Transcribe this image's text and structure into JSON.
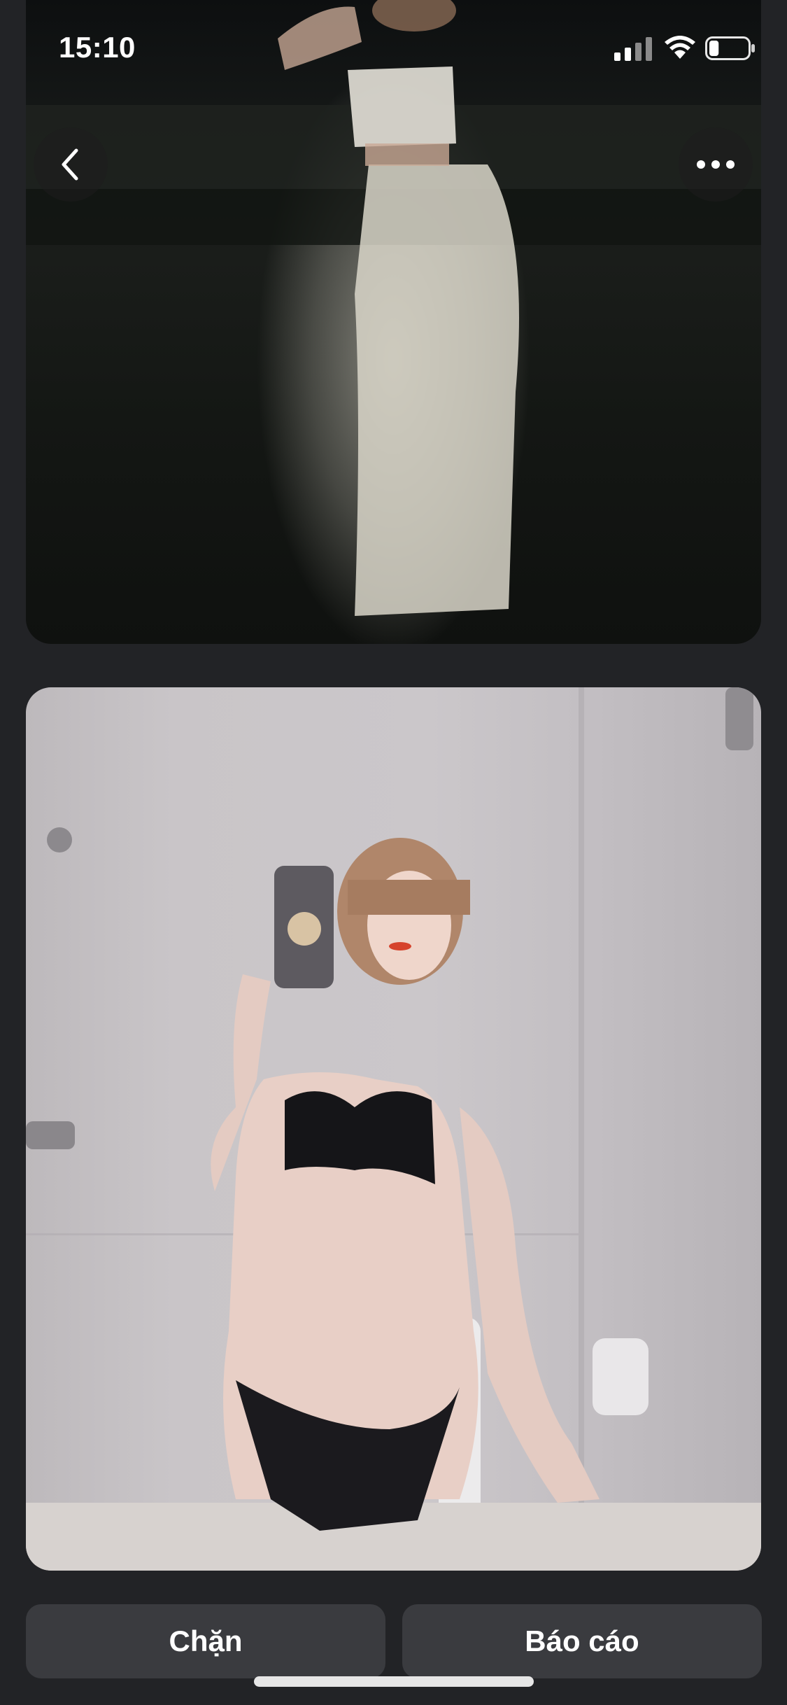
{
  "status_bar": {
    "time": "15:10",
    "signal_icon": "cellular-signal-icon",
    "wifi_icon": "wifi-icon",
    "battery_icon": "battery-icon",
    "battery_level": 0.25
  },
  "header": {
    "back_icon": "chevron-left-icon",
    "more_icon": "ellipsis-icon"
  },
  "gallery": {
    "photos": [
      {
        "kind": "photo",
        "scene": "night-outdoor"
      },
      {
        "kind": "photo",
        "scene": "bathroom-mirror-selfie"
      }
    ]
  },
  "actions": {
    "block_label": "Chặn",
    "report_label": "Báo cáo"
  },
  "colors": {
    "background": "#222326",
    "button_bg": "#3a3b3f",
    "text": "#ffffff"
  }
}
